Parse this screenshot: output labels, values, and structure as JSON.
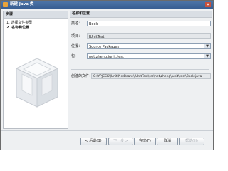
{
  "window": {
    "title": "新建 Java 类"
  },
  "steps": {
    "header": "步骤",
    "items": [
      {
        "num": "1.",
        "label": "选择文件类型"
      },
      {
        "num": "2.",
        "label": "名称和位置"
      }
    ]
  },
  "panel": {
    "title": "名称和位置",
    "class_name": {
      "label": "类名：",
      "value": "Book"
    },
    "project": {
      "label": "项目：",
      "value": "JUnitTest"
    },
    "location": {
      "label": "位置：",
      "value": "Source Packages"
    },
    "package": {
      "label": "包：",
      "value": "net.zheng.junit.test"
    },
    "created_file": {
      "label": "创建的文件：",
      "value": "G:\\YPJCCK\\JUnit\\NetBeans\\JUnitTest\\src\\net\\zheng\\junit\\test\\Book.java"
    }
  },
  "buttons": {
    "back": "< 后退(B)",
    "next": "下一步 >",
    "finish": "完成(F)",
    "cancel": "取消",
    "help": "帮助(H)"
  }
}
